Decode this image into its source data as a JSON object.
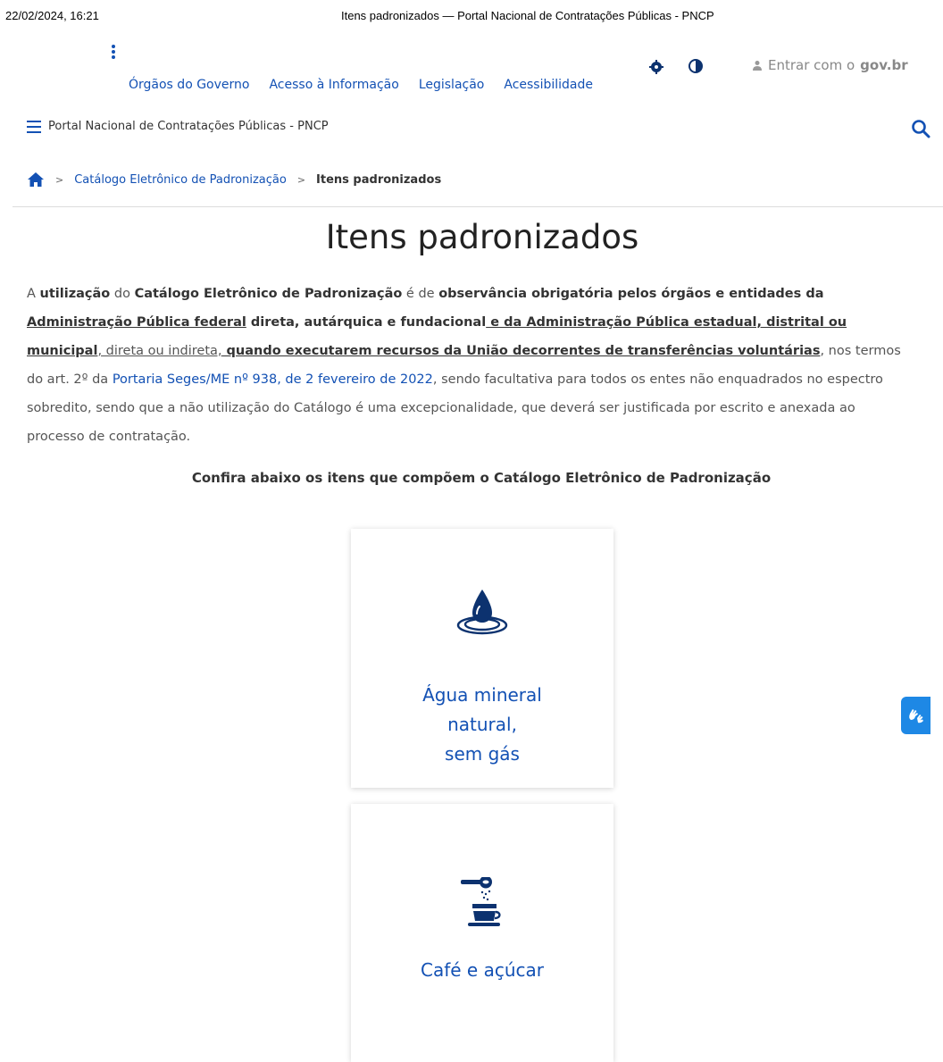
{
  "print_header": {
    "datetime": "22/02/2024, 16:21",
    "doc_title": "Itens padronizados — Portal Nacional de Contratações Públicas - PNCP"
  },
  "gov_links": [
    {
      "label": "Órgãos do Governo"
    },
    {
      "label": "Acesso à Informação"
    },
    {
      "label": "Legislação"
    },
    {
      "label": "Acessibilidade"
    }
  ],
  "login": {
    "label": "Entrar com o",
    "brand": "gov.br"
  },
  "header": {
    "title": "Portal Nacional de Contratações Públicas - PNCP"
  },
  "breadcrumb": {
    "items": [
      {
        "label": "Catálogo Eletrônico de Padronização"
      },
      {
        "label": "Itens padronizados"
      }
    ],
    "separator": ">"
  },
  "page": {
    "title": "Itens padronizados",
    "intro": {
      "p1": "A ",
      "b1": "utilização",
      "p2": " do ",
      "b2": "Catálogo Eletrônico de Padronização",
      "p3": " é de ",
      "b3": "observância obrigatória pelos órgãos e entidades da",
      "u1": "Administração Pública federal",
      "b4": " direta, autárquica e fundacional",
      "u2": " e da Administração Pública estadual, distrital ou municipal",
      "p4": ", direta ou indireta,",
      "u3": " quando executarem recursos da União decorrentes de transferências voluntárias",
      "p5": ", nos termos do art. 2º da ",
      "link": "Portaria Seges/ME nº 938, de 2 fevereiro de 2022",
      "p6": ", sendo facultativa para todos os entes não enquadrados no espectro sobredito, sendo que a não utilização do Catálogo é uma excepcionalidade, que deverá ser justificada por escrito e anexada ao processo de contratação."
    },
    "subtitle": "Confira abaixo os itens que compõem o Catálogo Eletrônico de Padronização"
  },
  "cards": [
    {
      "label_line1": "Água mineral natural,",
      "label_line2": "sem gás",
      "icon": "water-drop-icon"
    },
    {
      "label_line1": "Café e açúcar",
      "icon": "coffee-sugar-icon"
    }
  ],
  "colors": {
    "primary": "#1351b4",
    "card_icon": "#0c326f",
    "vlibras": "#1e88e5"
  }
}
